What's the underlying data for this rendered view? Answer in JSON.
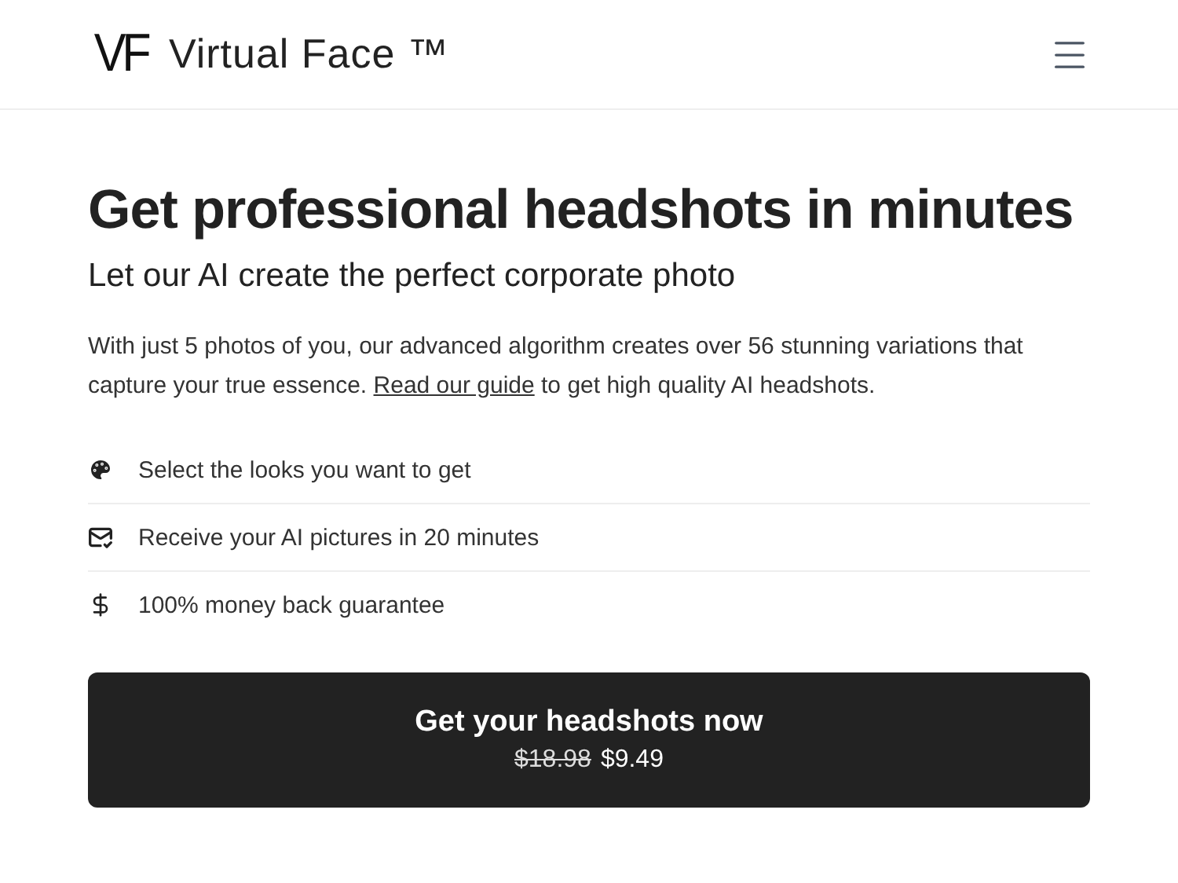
{
  "header": {
    "logo": "VF",
    "brand": "Virtual Face ™"
  },
  "hero": {
    "title": "Get professional headshots in minutes",
    "subtitle": "Let our AI create the perfect corporate photo",
    "paragraph": {
      "before": "With just 5 photos of you, our advanced algorithm creates over 56 stunning variations that capture your true essence. ",
      "link": "Read our guide",
      "after": " to get high quality AI headshots."
    }
  },
  "features": [
    {
      "kind": "palette",
      "text": "Select the looks you want to get"
    },
    {
      "kind": "mail",
      "text": "Receive your AI pictures in 20 minutes"
    },
    {
      "kind": "dollar",
      "text": "100% money back guarantee"
    }
  ],
  "cta": {
    "label": "Get your headshots now",
    "old_price": "$18.98",
    "price": "$9.49"
  }
}
